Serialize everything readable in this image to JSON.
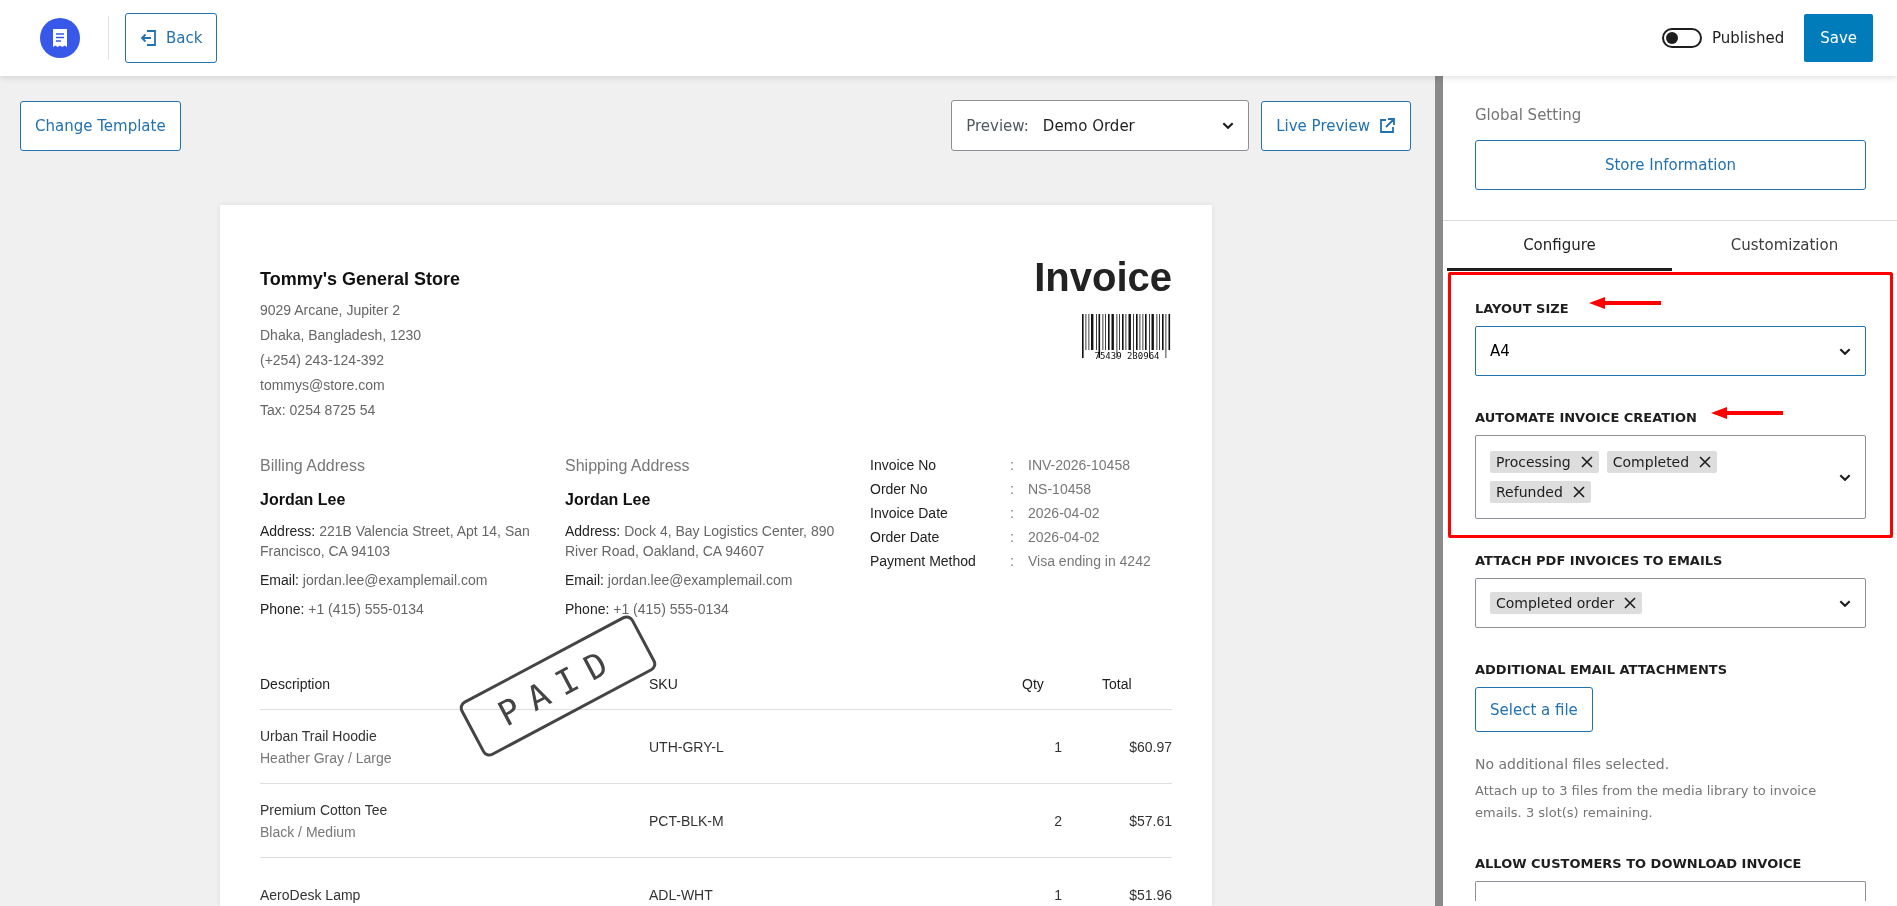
{
  "top_bar": {
    "back_label": "Back",
    "publish_toggle": {
      "label": "Published",
      "on": false
    },
    "save_label": "Save"
  },
  "toolbar": {
    "change_template": "Change Template",
    "preview_label": "Preview:",
    "preview_value": "Demo Order",
    "live_preview": "Live Preview"
  },
  "invoice": {
    "store_name": "Tommy's General Store",
    "store_lines": [
      "9029 Arcane, Jupiter 2",
      "Dhaka, Bangladesh, 1230",
      "(+254) 243-124-392",
      "tommys@store.com",
      "Tax: 0254 8725 54"
    ],
    "title": "Invoice",
    "barcode_number": "75439  230964",
    "stamp": "PAID",
    "addresses": [
      {
        "heading": "Billing Address",
        "name": "Jordan Lee",
        "fields": [
          {
            "label": "Address:",
            "value": "221B Valencia Street, Apt 14, San Francisco, CA 94103"
          },
          {
            "label": "Email:",
            "value": "jordan.lee@examplemail.com"
          },
          {
            "label": "Phone:",
            "value": "+1 (415) 555-0134"
          }
        ]
      },
      {
        "heading": "Shipping Address",
        "name": "Jordan Lee",
        "fields": [
          {
            "label": "Address:",
            "value": "Dock 4, Bay Logistics Center, 890 River Road, Oakland, CA 94607"
          },
          {
            "label": "Email:",
            "value": "jordan.lee@examplemail.com"
          },
          {
            "label": "Phone:",
            "value": "+1 (415) 555-0134"
          }
        ]
      }
    ],
    "meta": [
      {
        "label": "Invoice No",
        "sep": ":",
        "value": "INV-2026-10458"
      },
      {
        "label": "Order No",
        "sep": ":",
        "value": "NS-10458"
      },
      {
        "label": "Invoice Date",
        "sep": ":",
        "value": "2026-04-02"
      },
      {
        "label": "Order Date",
        "sep": ":",
        "value": "2026-04-02"
      },
      {
        "label": "Payment Method",
        "sep": ":",
        "value": "Visa ending in 4242"
      }
    ],
    "table": {
      "columns": [
        "Description",
        "SKU",
        "Qty",
        "Total"
      ],
      "rows": [
        {
          "name": "Urban Trail Hoodie",
          "variant": "Heather Gray / Large",
          "sku": "UTH-GRY-L",
          "qty": "1",
          "total": "$60.97"
        },
        {
          "name": "Premium Cotton Tee",
          "variant": "Black / Medium",
          "sku": "PCT-BLK-M",
          "qty": "2",
          "total": "$57.61"
        },
        {
          "name": "AeroDesk Lamp",
          "sku": "ADL-WHT",
          "qty": "1",
          "total": "$51.96"
        }
      ]
    }
  },
  "sidebar": {
    "section_title": "Global Setting",
    "store_button": "Store Information",
    "tabs": [
      {
        "label": "Configure",
        "selected": true
      },
      {
        "label": "Customization",
        "selected": false
      }
    ],
    "layout_size": {
      "label": "LAYOUT SIZE",
      "value": "A4"
    },
    "automate": {
      "label": "AUTOMATE INVOICE CREATION",
      "tags": [
        "Processing",
        "Completed",
        "Refunded"
      ]
    },
    "attach_pdf": {
      "label": "ATTACH PDF INVOICES TO EMAILS",
      "tags": [
        "Completed order"
      ]
    },
    "attachments": {
      "label": "ADDITIONAL EMAIL ATTACHMENTS",
      "button": "Select a file",
      "status": "No additional files selected.",
      "help": "Attach up to 3 files from the media library to invoice emails. 3 slot(s) remaining."
    },
    "download": {
      "label": "ALLOW CUSTOMERS TO DOWNLOAD INVOICE"
    }
  }
}
